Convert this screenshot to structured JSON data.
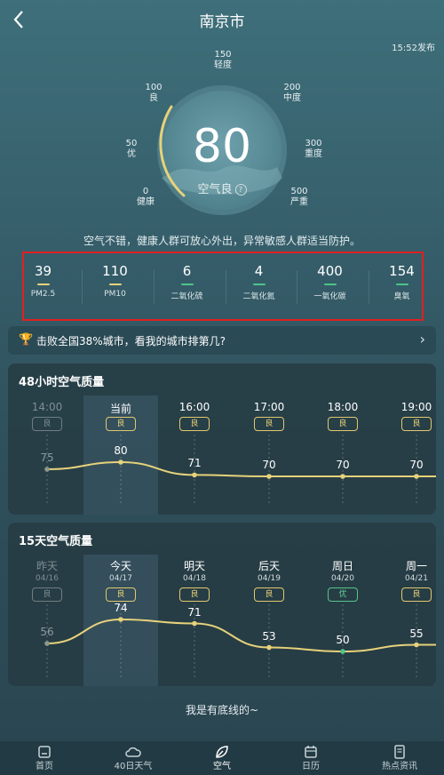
{
  "header": {
    "title": "南京市",
    "publish_time": "15:52发布"
  },
  "gauge": {
    "value": "80",
    "grade": "空气良",
    "help": "?",
    "scale": [
      {
        "num": "0",
        "label": "健康"
      },
      {
        "num": "50",
        "label": "优"
      },
      {
        "num": "100",
        "label": "良"
      },
      {
        "num": "150",
        "label": "轻度"
      },
      {
        "num": "200",
        "label": "中度"
      },
      {
        "num": "300",
        "label": "重度"
      },
      {
        "num": "500",
        "label": "严重"
      }
    ],
    "accent": "#e6d27a"
  },
  "advice": "空气不错，健康人群可放心外出，异常敏感人群适当防护。",
  "pollutants": [
    {
      "value": "39",
      "name": "PM2.5",
      "color": "#e6d27a"
    },
    {
      "value": "110",
      "name": "PM10",
      "color": "#e6d27a"
    },
    {
      "value": "6",
      "name": "二氧化硫",
      "color": "#4fc48a"
    },
    {
      "value": "4",
      "name": "二氧化氮",
      "color": "#4fc48a"
    },
    {
      "value": "400",
      "name": "一氧化碳",
      "color": "#4fc48a"
    },
    {
      "value": "154",
      "name": "臭氧",
      "color": "#4fc48a"
    }
  ],
  "rank_banner": {
    "text": "击败全国38%城市，看我的城市排第几?",
    "icon": "trophy-icon"
  },
  "hourly": {
    "title": "48小时空气质量",
    "items": [
      {
        "time": "14:00",
        "grade": "良",
        "aqi": 75,
        "past": true
      },
      {
        "time": "当前",
        "grade": "良",
        "aqi": 80,
        "now": true
      },
      {
        "time": "16:00",
        "grade": "良",
        "aqi": 71
      },
      {
        "time": "17:00",
        "grade": "良",
        "aqi": 70
      },
      {
        "time": "18:00",
        "grade": "良",
        "aqi": 70
      },
      {
        "time": "19:00",
        "grade": "良",
        "aqi": 70
      }
    ]
  },
  "daily": {
    "title": "15天空气质量",
    "items": [
      {
        "day": "昨天",
        "date": "04/16",
        "grade": "良",
        "aqi": 56,
        "past": true
      },
      {
        "day": "今天",
        "date": "04/17",
        "grade": "良",
        "aqi": 74,
        "now": true
      },
      {
        "day": "明天",
        "date": "04/18",
        "grade": "良",
        "aqi": 71
      },
      {
        "day": "后天",
        "date": "04/19",
        "grade": "良",
        "aqi": 53
      },
      {
        "day": "周日",
        "date": "04/20",
        "grade": "优",
        "aqi": 50,
        "good": true
      },
      {
        "day": "周一",
        "date": "04/21",
        "grade": "良",
        "aqi": 55
      }
    ]
  },
  "footer": "我是有底线的~",
  "tabs": [
    {
      "label": "首页",
      "icon": "home-icon"
    },
    {
      "label": "40日天气",
      "icon": "cloud-icon"
    },
    {
      "label": "空气",
      "icon": "leaf-icon",
      "active": true
    },
    {
      "label": "日历",
      "icon": "calendar-icon"
    },
    {
      "label": "热点资讯",
      "icon": "news-icon"
    }
  ]
}
